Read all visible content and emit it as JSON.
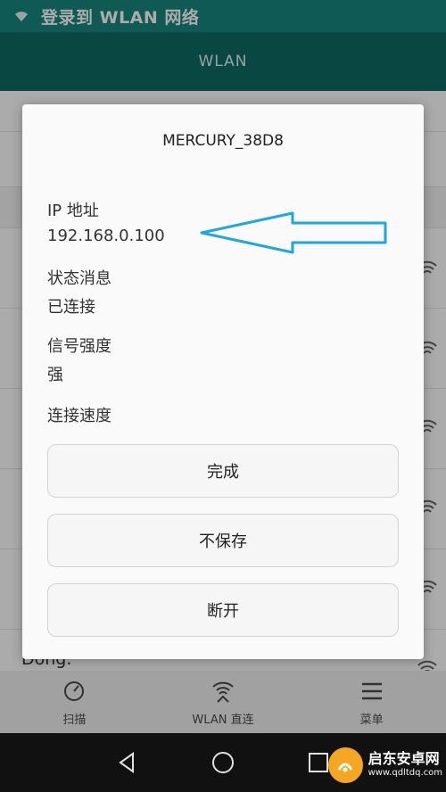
{
  "status_bar": {
    "title": "登录到 WLAN 网络",
    "icon": "wifi-icon"
  },
  "app_bar": {
    "title": "WLAN"
  },
  "background": {
    "peek_text": "Dong."
  },
  "dialog": {
    "title": "MERCURY_38D8",
    "fields": [
      {
        "label": "IP 地址",
        "value": "192.168.0.100"
      },
      {
        "label": "状态消息",
        "value": "已连接"
      },
      {
        "label": "信号强度",
        "value": "强"
      },
      {
        "label": "连接速度",
        "value": ""
      }
    ],
    "buttons": {
      "done": "完成",
      "forget": "不保存",
      "disconnect": "断开"
    },
    "annotation_color": "#1ea7e0"
  },
  "bottom_bar": {
    "scan": "扫描",
    "wlan_direct": "WLAN 直连",
    "menu": "菜单"
  },
  "watermark": {
    "name": "启东安卓网",
    "url": "www.qdltdq.com"
  },
  "colors": {
    "status_bar": "#17867e",
    "app_bar": "#0e6a63"
  }
}
